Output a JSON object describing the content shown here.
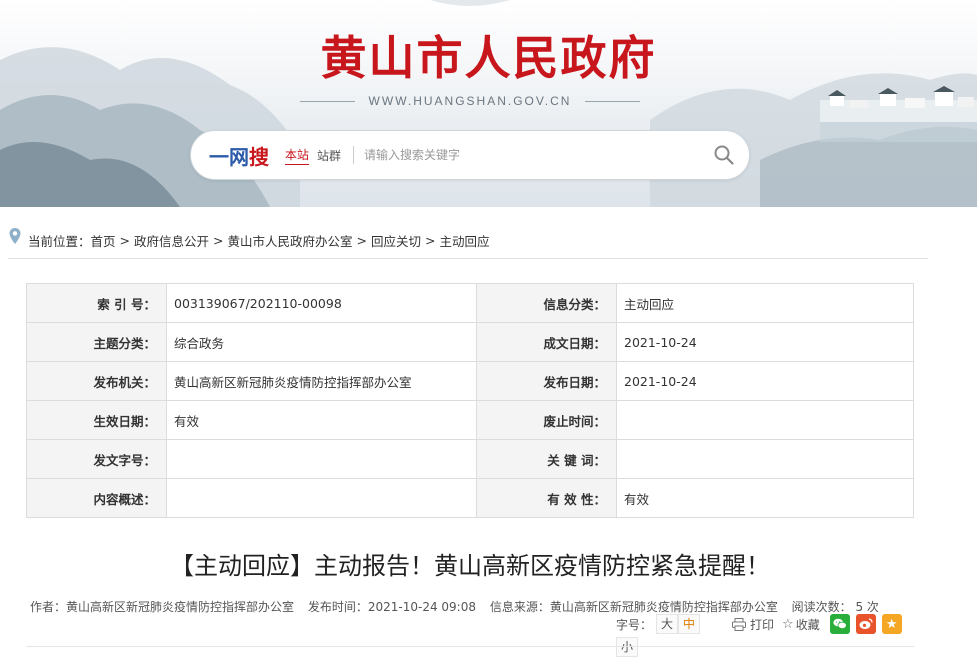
{
  "header": {
    "site_title": "黄山市人民政府",
    "site_url": "WWW.HUANGSHAN.GOV.CN"
  },
  "search": {
    "logo_part1": "一网",
    "logo_part2": "搜",
    "scope_site": "本站",
    "scope_group": "站群",
    "placeholder": "请输入搜索关键字",
    "icons": {
      "search": "search-icon"
    }
  },
  "breadcrumb": {
    "prefix": "当前位置：",
    "items": [
      "首页",
      "政府信息公开",
      "黄山市人民政府办公室",
      "回应关切",
      "主动回应"
    ],
    "separator": ">"
  },
  "info_table": {
    "rows": [
      {
        "label1": "索 引 号：",
        "value1": "003139067/202110-00098",
        "label2": "信息分类：",
        "value2": "主动回应"
      },
      {
        "label1": "主题分类：",
        "value1": "综合政务",
        "label2": "成文日期：",
        "value2": "2021-10-24"
      },
      {
        "label1": "发布机关：",
        "value1": "黄山高新区新冠肺炎疫情防控指挥部办公室",
        "label2": "发布日期：",
        "value2": "2021-10-24"
      },
      {
        "label1": "生效日期：",
        "value1": "有效",
        "label2": "废止时间：",
        "value2": ""
      },
      {
        "label1": "发文字号：",
        "value1": "",
        "label2": "关 键 词：",
        "value2": ""
      },
      {
        "label1": "内容概述：",
        "value1": "",
        "label2": "有 效 性：",
        "value2": "有效"
      }
    ]
  },
  "article": {
    "title": "【主动回应】主动报告！黄山高新区疫情防控紧急提醒！",
    "meta": {
      "author": "作者：黄山高新区新冠肺炎疫情防控指挥部办公室",
      "publish_time": "发布时间：2021-10-24 09:08",
      "source": "信息来源：黄山高新区新冠肺炎疫情防控指挥部办公室",
      "read_count": "阅读次数： 5 次"
    }
  },
  "tools": {
    "font_size_label": "字号：",
    "font_large": "大",
    "font_medium": "中",
    "font_small": "小",
    "print": "打印",
    "favorite": "收藏",
    "colors": {
      "wechat": "#2aae3a",
      "weibo": "#e8532b",
      "qzone": "#f5a623",
      "accent": "#c8161d"
    }
  }
}
